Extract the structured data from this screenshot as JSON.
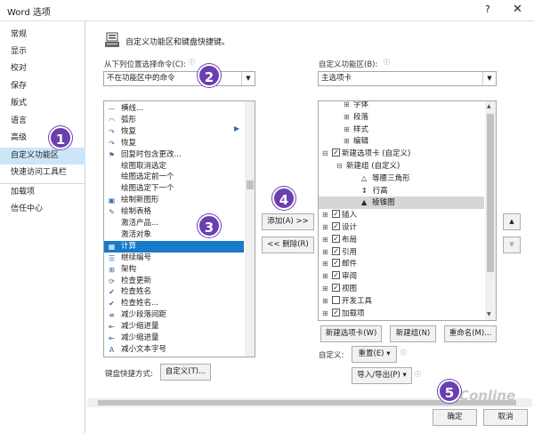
{
  "window": {
    "title": "Word 选项",
    "help": "?",
    "close": "✕"
  },
  "sidebar": {
    "items": [
      {
        "label": "常规"
      },
      {
        "label": "显示"
      },
      {
        "label": "校对"
      },
      {
        "label": "保存"
      },
      {
        "label": "版式"
      },
      {
        "label": "语言"
      },
      {
        "label": "高级"
      },
      {
        "label": "自定义功能区"
      },
      {
        "label": "快速访问工具栏"
      },
      {
        "label": "加载项"
      },
      {
        "label": "信任中心"
      }
    ],
    "selected": "自定义功能区"
  },
  "header": {
    "text": "自定义功能区和键盘快捷键。"
  },
  "left": {
    "label": "从下列位置选择命令(C):",
    "combo_value": "不在功能区中的命令",
    "commands": [
      {
        "label": "横线...",
        "icon": "line-icon"
      },
      {
        "label": "弧形",
        "icon": "arc-icon"
      },
      {
        "label": "恢复",
        "icon": "redo-icon"
      },
      {
        "label": "恢复",
        "icon": "redo-icon"
      },
      {
        "label": "回复时包含更改...",
        "icon": "reply-icon"
      },
      {
        "label": "绘图取消选定",
        "icon": "none"
      },
      {
        "label": "绘图选定前一个",
        "icon": "none"
      },
      {
        "label": "绘图选定下一个",
        "icon": "none"
      },
      {
        "label": "绘制新图形",
        "icon": "canvas-icon"
      },
      {
        "label": "绘制表格",
        "icon": "pencil-icon"
      },
      {
        "label": "激活产品...",
        "icon": "none"
      },
      {
        "label": "激活对象",
        "icon": "none"
      },
      {
        "label": "计算",
        "icon": "calc-icon"
      },
      {
        "label": "继续编号",
        "icon": "numbering-icon"
      },
      {
        "label": "架构",
        "icon": "schema-icon"
      },
      {
        "label": "检查更新",
        "icon": "update-icon"
      },
      {
        "label": "检查姓名",
        "icon": "names-icon"
      },
      {
        "label": "检查姓名...",
        "icon": "names-icon"
      },
      {
        "label": "减少段落间距",
        "icon": "spacing-icon"
      },
      {
        "label": "减少缩进量",
        "icon": "indent-icon"
      },
      {
        "label": "减少缩进量",
        "icon": "indent-icon"
      },
      {
        "label": "减小文本字号",
        "icon": "font-size-icon"
      }
    ],
    "selected": "计算"
  },
  "middle": {
    "add": "添加(A) >>",
    "remove": "<< 删除(R)"
  },
  "right": {
    "label": "自定义功能区(B):",
    "combo_value": "主选项卡",
    "tree": [
      {
        "label": "字体",
        "level": 2,
        "expander": "⊞",
        "check": null
      },
      {
        "label": "段落",
        "level": 2,
        "expander": "⊞",
        "check": null
      },
      {
        "label": "样式",
        "level": 2,
        "expander": "⊞",
        "check": null
      },
      {
        "label": "编辑",
        "level": 2,
        "expander": "⊞",
        "check": null
      },
      {
        "label": "新建选项卡 (自定义)",
        "level": 0,
        "expander": "⊟",
        "check": true
      },
      {
        "label": "新建组 (自定义)",
        "level": 1,
        "expander": "⊟",
        "check": null
      },
      {
        "label": "等腰三角形",
        "level": 3,
        "expander": "",
        "check": null,
        "icon": "triangle-icon"
      },
      {
        "label": "行高",
        "level": 3,
        "expander": "",
        "check": null,
        "icon": "line-height-icon"
      },
      {
        "label": "棱锥图",
        "level": 3,
        "expander": "",
        "check": null,
        "icon": "pyramid-icon"
      },
      {
        "label": "插入",
        "level": 0,
        "expander": "⊞",
        "check": true
      },
      {
        "label": "设计",
        "level": 0,
        "expander": "⊞",
        "check": true
      },
      {
        "label": "布局",
        "level": 0,
        "expander": "⊞",
        "check": true
      },
      {
        "label": "引用",
        "level": 0,
        "expander": "⊞",
        "check": true
      },
      {
        "label": "邮件",
        "level": 0,
        "expander": "⊞",
        "check": true
      },
      {
        "label": "审阅",
        "level": 0,
        "expander": "⊞",
        "check": true
      },
      {
        "label": "视图",
        "level": 0,
        "expander": "⊞",
        "check": true
      },
      {
        "label": "开发工具",
        "level": 0,
        "expander": "⊞",
        "check": false
      },
      {
        "label": "加载项",
        "level": 0,
        "expander": "⊞",
        "check": true
      }
    ],
    "selected": "棱锥图",
    "new_tab": "新建选项卡(W)",
    "new_group": "新建组(N)",
    "rename": "重命名(M)...",
    "custom_label": "自定义:",
    "reset": "重置(E) ▾",
    "import_export": "导入/导出(P) ▾"
  },
  "keyboard": {
    "label": "键盘快捷方式:",
    "button": "自定义(T)..."
  },
  "footer": {
    "ok": "确定",
    "cancel": "取消"
  },
  "badges": [
    "1",
    "2",
    "3",
    "4",
    "5"
  ],
  "watermark": "PConline",
  "colors": {
    "selection": "#1979ca",
    "nav_selected": "#cde6f7",
    "badge": "#6a3fb0"
  }
}
